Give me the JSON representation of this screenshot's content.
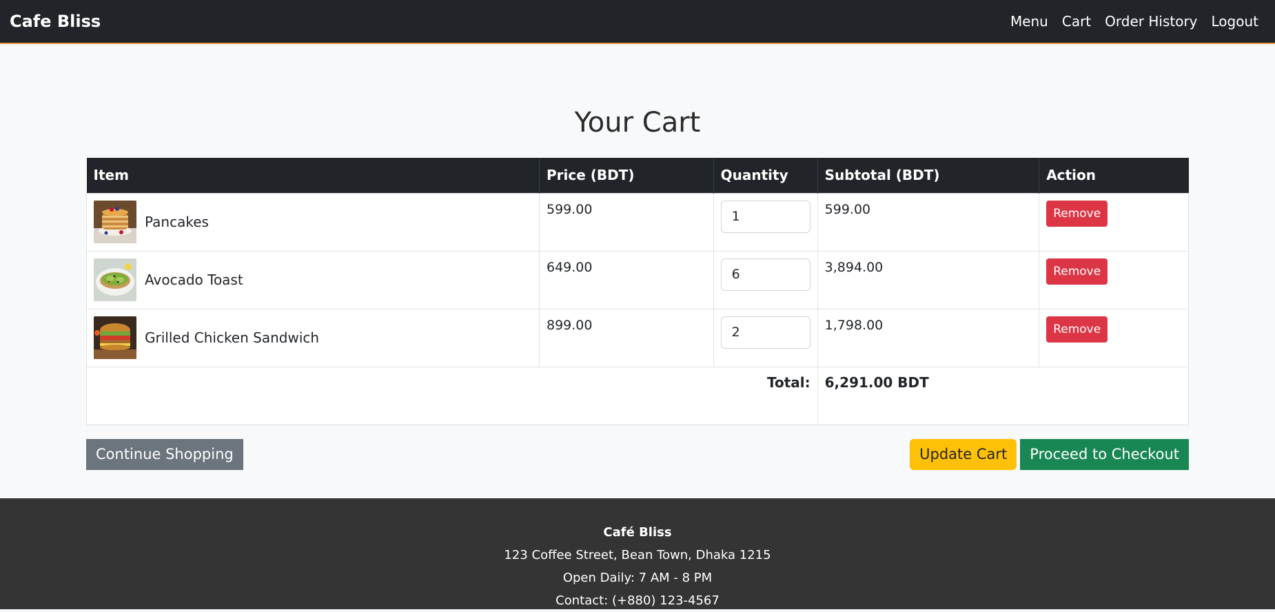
{
  "navbar": {
    "brand": "Cafe Bliss",
    "links": [
      "Menu",
      "Cart",
      "Order History",
      "Logout"
    ]
  },
  "page": {
    "title": "Your Cart"
  },
  "table": {
    "headers": [
      "Item",
      "Price (BDT)",
      "Quantity",
      "Subtotal (BDT)",
      "Action"
    ],
    "rows": [
      {
        "name": "Pancakes",
        "price": "599.00",
        "quantity": "1",
        "subtotal": "599.00",
        "action": "Remove"
      },
      {
        "name": "Avocado Toast",
        "price": "649.00",
        "quantity": "6",
        "subtotal": "3,894.00",
        "action": "Remove"
      },
      {
        "name": "Grilled Chicken Sandwich",
        "price": "899.00",
        "quantity": "2",
        "subtotal": "1,798.00",
        "action": "Remove"
      }
    ],
    "total_label": "Total:",
    "total_value": "6,291.00 BDT"
  },
  "buttons": {
    "continue": "Continue Shopping",
    "update": "Update Cart",
    "checkout": "Proceed to Checkout"
  },
  "footer": {
    "title": "Café Bliss",
    "address": "123 Coffee Street, Bean Town, Dhaka 1215",
    "hours": "Open Daily: 7 AM - 8 PM",
    "contact": "Contact: (+880) 123-4567"
  },
  "colors": {
    "navbar_bg": "#212529",
    "navbar_accent": "#e59a4e",
    "remove": "#dc3545",
    "update": "#ffc107",
    "checkout": "#198754",
    "continue": "#6c757d",
    "footer_bg": "#343434"
  }
}
